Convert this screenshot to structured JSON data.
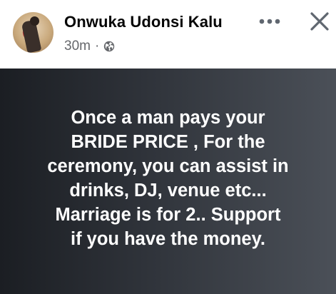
{
  "post": {
    "author_name": "Onwuka Udonsi Kalu",
    "timestamp": "30m",
    "separator": "·",
    "audience_icon": "globe-icon",
    "more_icon": "more-options-icon",
    "close_icon": "close-icon",
    "text": "Once a man pays  your\nBRIDE PRICE , For the\nceremony, you can assist in\ndrinks, DJ, venue etc...\nMarriage is for 2.. Support\nif you have the money.",
    "colors": {
      "author": "#050505",
      "meta": "#65676b",
      "background_dark": "#1b1e23",
      "background_light": "#4b5058",
      "text": "#ffffff"
    }
  }
}
